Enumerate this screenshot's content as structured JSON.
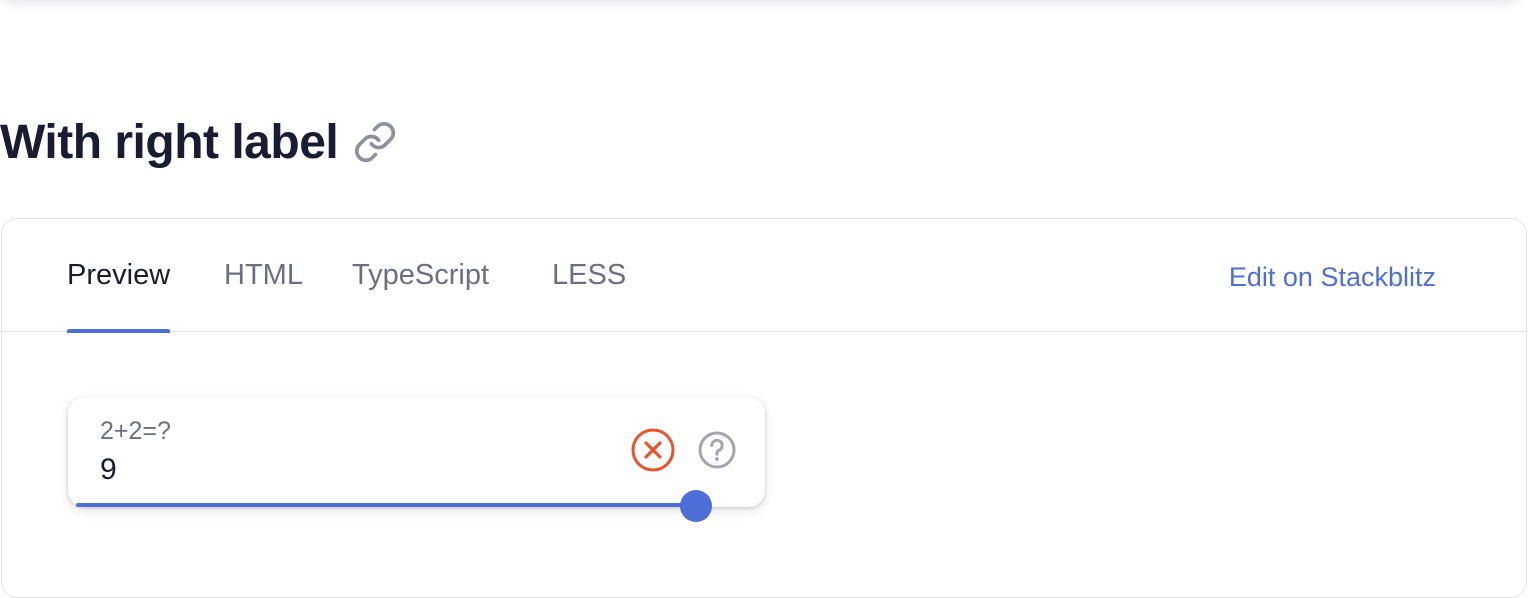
{
  "section": {
    "title": "With right label"
  },
  "tabs": [
    {
      "label": "Preview",
      "active": true
    },
    {
      "label": "HTML",
      "active": false
    },
    {
      "label": "TypeScript",
      "active": false
    },
    {
      "label": "LESS",
      "active": false
    }
  ],
  "edit_link": "Edit on Stackblitz",
  "field": {
    "label": "2+2=?",
    "value": "9",
    "progress_fraction": 1.0
  },
  "icons": {
    "link": "link-icon",
    "clear": "close-circle-icon",
    "help": "question-circle-icon"
  },
  "colors": {
    "accent": "#4f6fd8",
    "error": "#e8552c",
    "muted_icon": "#a3a5b0"
  }
}
